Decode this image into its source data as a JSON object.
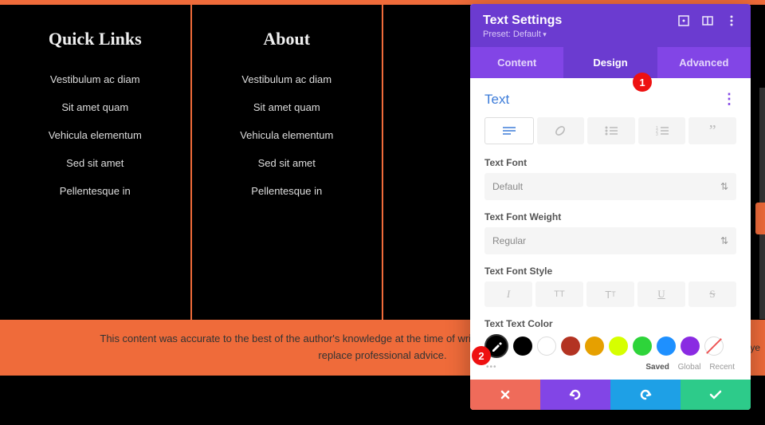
{
  "footer": {
    "columns": [
      {
        "heading": "Quick Links",
        "links": [
          "Vestibulum ac diam",
          "Sit amet quam",
          "Vehicula elementum",
          "Sed sit amet",
          "Pellentesque in"
        ]
      },
      {
        "heading": "About",
        "links": [
          "Vestibulum ac diam",
          "Sit amet quam",
          "Vehicula elementum",
          "Sed sit amet",
          "Pellentesque in"
        ]
      },
      {
        "heading": "",
        "links": []
      },
      {
        "heading": "",
        "links": []
      }
    ],
    "disclaimer": "This content was accurate to the best of the author's knowledge at the time of writing. It is intended only and is not meant to replace professional advice.",
    "right_label": "waye"
  },
  "panel": {
    "title": "Text Settings",
    "preset": "Preset: Default",
    "tabs": {
      "content": "Content",
      "design": "Design",
      "advanced": "Advanced"
    },
    "section_title": "Text",
    "labels": {
      "font": "Text Font",
      "weight": "Text Font Weight",
      "style": "Text Font Style",
      "color": "Text Text Color"
    },
    "font_value": "Default",
    "weight_value": "Regular",
    "meta": {
      "saved": "Saved",
      "global": "Global",
      "recent": "Recent"
    },
    "swatches": [
      "#000000",
      "#ffffff",
      "#b33322",
      "#e6a000",
      "#d6ff00",
      "#2ed43a",
      "#1e90ff",
      "#8a2be2"
    ]
  },
  "annotations": {
    "one": "1",
    "two": "2"
  }
}
